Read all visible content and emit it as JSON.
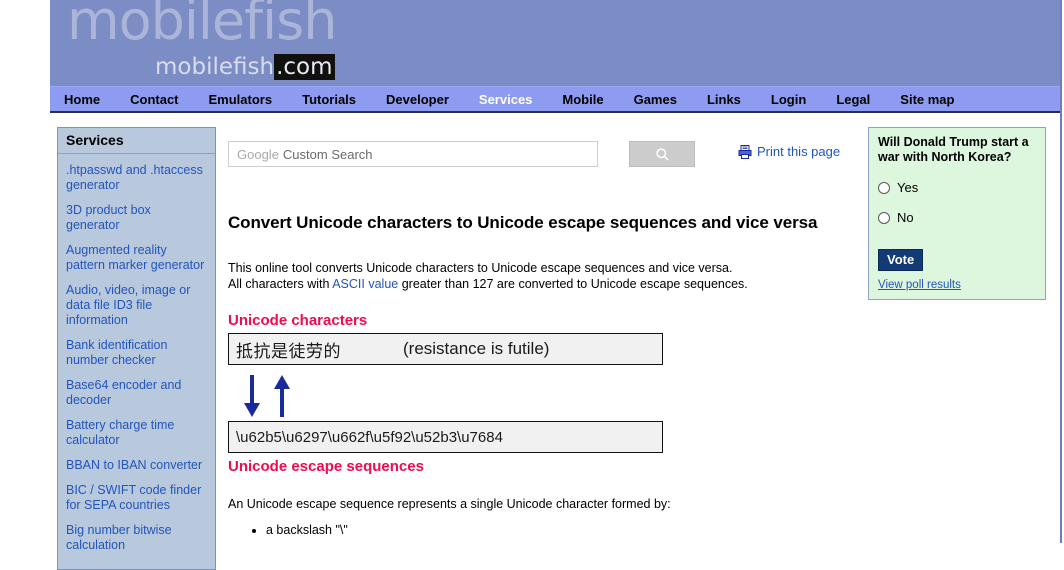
{
  "site": {
    "logo_big": "mobilefish",
    "logo_small": "mobilefish",
    "logo_tld": ".com"
  },
  "nav": {
    "items": [
      {
        "label": "Home",
        "active": false
      },
      {
        "label": "Contact",
        "active": false
      },
      {
        "label": "Emulators",
        "active": false
      },
      {
        "label": "Tutorials",
        "active": false
      },
      {
        "label": "Developer",
        "active": false
      },
      {
        "label": "Services",
        "active": true
      },
      {
        "label": "Mobile",
        "active": false
      },
      {
        "label": "Games",
        "active": false
      },
      {
        "label": "Links",
        "active": false
      },
      {
        "label": "Login",
        "active": false
      },
      {
        "label": "Legal",
        "active": false
      },
      {
        "label": "Site map",
        "active": false
      }
    ]
  },
  "sidebar": {
    "header": "Services",
    "items": [
      {
        "label": ".htpasswd and .htaccess generator"
      },
      {
        "label": "3D product box generator"
      },
      {
        "label": "Augmented reality pattern marker generator"
      },
      {
        "label": "Audio, video, image or data file ID3 file information"
      },
      {
        "label": "Bank identification number checker"
      },
      {
        "label": "Base64 encoder and decoder"
      },
      {
        "label": "Battery charge time calculator"
      },
      {
        "label": "BBAN to IBAN converter"
      },
      {
        "label": "BIC / SWIFT code finder for SEPA countries"
      },
      {
        "label": "Big number bitwise calculation"
      }
    ]
  },
  "search": {
    "brand": "Google",
    "placeholder": "Custom Search",
    "value": "",
    "button_icon": "search-icon"
  },
  "print": {
    "label": "Print this page",
    "icon": "printer-icon"
  },
  "main": {
    "title": "Convert Unicode characters to Unicode escape sequences and vice versa",
    "intro_line1": "This online tool converts Unicode characters to Unicode escape sequences and vice versa.",
    "intro_line2_pre": "All characters with ",
    "intro_link": "ASCII value",
    "intro_line2_post": " greater than 127 are converted to Unicode escape sequences.",
    "input_label": "Unicode characters",
    "input_cjk": "抵抗是徒劳的",
    "input_translation": "(resistance is futile)",
    "output_label": "Unicode escape sequences",
    "output_value": "\\u62b5\\u6297\\u662f\\u5f92\\u52b3\\u7684",
    "explain": "An Unicode escape sequence represents a single Unicode character formed by:",
    "bullets": [
      "a backslash \"\\\""
    ]
  },
  "poll": {
    "question": "Will Donald Trump start a war with North Korea?",
    "options": [
      "Yes",
      "No"
    ],
    "vote_label": "Vote",
    "results_label": "View poll results"
  },
  "colors": {
    "banner": "#7c8cc4",
    "navbar": "#8d9cf0",
    "sidebar": "#b8c8dd",
    "link": "#2255bb",
    "label_red": "#ef0b4e",
    "poll_bg": "#ddf6de",
    "vote_bg": "#123a75",
    "arrow": "#1a2a9c"
  }
}
